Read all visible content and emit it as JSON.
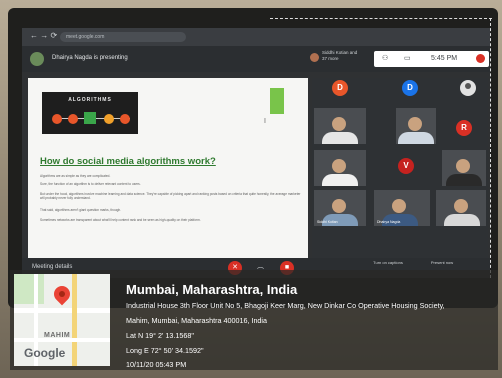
{
  "browser": {
    "url": "meet.google.com",
    "nav": "← →  ⟳"
  },
  "meet": {
    "presenting_text": "Dhairya Nagda is presenting",
    "participants_text": "Siddhi Kotian and 37 more",
    "time": "5:45 PM",
    "meeting_details": "Meeting details",
    "present_label": "Turn on captions",
    "present_now_label": "Present now"
  },
  "slide": {
    "algo_title": "ALGORITHMS",
    "heading": "How do social media algorithms work?",
    "paragraphs": [
      "Algorithms are as simple as they are complicated.",
      "Sure, the function of an algorithm is to deliver relevant content to users.",
      "But under the hood, algorithms involve machine learning and data science. They're capable of picking apart and ranking posts based on criteria that quite honestly, the average marketer will probably never fully understand.",
      "That said, algorithms aren't giant question marks, though.",
      "Sometimes networks are transparent about what'll help content rank and be seen as high-quality on their platform."
    ]
  },
  "tiles": {
    "avatars": [
      {
        "letter": "D",
        "color": "#e8562a"
      },
      {
        "letter": "D",
        "color": "#1a73e8"
      },
      {
        "letter": "R",
        "color": "#d93025"
      },
      {
        "letter": "V",
        "color": "#d93025"
      }
    ],
    "labels": [
      "Siddhi Kotian",
      "Dhairya Nagda"
    ]
  },
  "location": {
    "title": "Mumbai, Maharashtra, India",
    "address_line1": "Industrial House 3th Floor Unit No 5, Bhagoji Keer Marg, New Dinkar Co Operative Housing Society,",
    "address_line2": "Mahim, Mumbai, Maharashtra 400016, India",
    "lat": "Lat N 19° 2' 13.1568\"",
    "long": "Long E 72° 50' 34.1592\"",
    "datetime": "10/11/20 05:43 PM",
    "map_label": "MAHIM",
    "map_logo": "Google"
  },
  "colors": {
    "heading_green": "#2f7a2f",
    "hangup_red": "#d93025",
    "pin_red": "#ea4335"
  }
}
